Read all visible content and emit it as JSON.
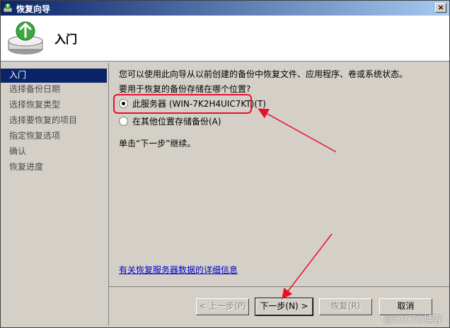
{
  "window": {
    "title": "恢复向导",
    "close_glyph": "×"
  },
  "header": {
    "heading": "入门"
  },
  "sidebar": {
    "items": [
      {
        "label": "入门"
      },
      {
        "label": "选择备份日期"
      },
      {
        "label": "选择恢复类型"
      },
      {
        "label": "选择要恢复的项目"
      },
      {
        "label": "指定恢复选项"
      },
      {
        "label": "确认"
      },
      {
        "label": "恢复进度"
      }
    ],
    "active_index": 0
  },
  "content": {
    "intro": "您可以使用此向导从以前创建的备份中恢复文件、应用程序、卷或系统状态。",
    "question": "要用于恢复的备份存储在哪个位置?",
    "options": [
      {
        "label": "此服务器 (WIN-7K2H4UIC7KT)(T)",
        "checked": true
      },
      {
        "label": "在其他位置存储备份(A)",
        "checked": false
      }
    ],
    "continue_text": "单击“下一步”继续。",
    "link_text": "有关恢复服务器数据的详细信息"
  },
  "buttons": {
    "prev": "< 上一步(P)",
    "next": "下一步(N) >",
    "recover": "恢复(R)",
    "cancel": "取消"
  },
  "watermark": "@51CTO博客",
  "colors": {
    "annotation": "#e8102a",
    "selection": "#0a246a",
    "link": "#0000cc"
  },
  "icons": {
    "window": "wizard-app-icon",
    "header": "server-restore-icon"
  }
}
